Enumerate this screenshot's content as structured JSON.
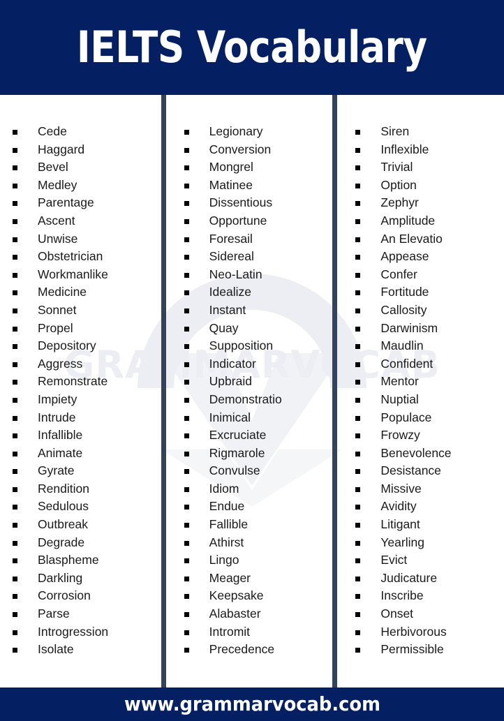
{
  "header": {
    "title": "IELTS Vocabulary",
    "background_color": "#042062",
    "text_color": "#ffffff"
  },
  "watermark": {
    "text": "GRAMMARVOCAB",
    "color": "#eceef3"
  },
  "theme": {
    "navy": "#042062",
    "divider": "#34425a",
    "bullet": "#000000",
    "word_text": "#1a1a1a",
    "page_background": "#ffffff"
  },
  "columns": [
    {
      "name": "column-1",
      "words": [
        "Cede",
        "Haggard",
        "Bevel",
        "Medley",
        "Parentage",
        "Ascent",
        "Unwise",
        "Obstetrician",
        "Workmanlike",
        "Medicine",
        "Sonnet",
        "Propel",
        "Depository",
        "Aggress",
        "Remonstrate",
        "Impiety",
        "Intrude",
        "Infallible",
        "Animate",
        "Gyrate",
        "Rendition",
        "Sedulous",
        "Outbreak",
        "Degrade",
        "Blaspheme",
        "Darkling",
        "Corrosion",
        "Parse",
        "Introgression",
        "Isolate"
      ]
    },
    {
      "name": "column-2",
      "words": [
        "Legionary",
        "Conversion",
        "Mongrel",
        "Matinee",
        "Dissentious",
        "Opportune",
        "Foresail",
        "Sidereal",
        "Neo-Latin",
        "Idealize",
        "Instant",
        "Quay",
        "Supposition",
        "Indicator",
        "Upbraid",
        "Demonstratio",
        "Inimical",
        "Excruciate",
        "Rigmarole",
        "Convulse",
        "Idiom",
        "Endue",
        "Fallible",
        "Athirst",
        "Lingo",
        "Meager",
        "Keepsake",
        "Alabaster",
        "Intromit",
        "Precedence"
      ]
    },
    {
      "name": "column-3",
      "words": [
        "Siren",
        "Inflexible",
        "Trivial",
        "Option",
        "Zephyr",
        "Amplitude",
        "An Elevatio",
        "Appease",
        "Confer",
        "Fortitude",
        "Callosity",
        "Darwinism",
        "Maudlin",
        "Confident",
        "Mentor",
        "Nuptial",
        "Populace",
        "Frowzy",
        "Benevolence",
        "Desistance",
        "Missive",
        "Avidity",
        "Litigant",
        "Yearling",
        "Evict",
        "Judicature",
        "Inscribe",
        "Onset",
        "Herbivorous",
        "Permissible"
      ]
    }
  ],
  "footer": {
    "url": "www.grammarvocab.com",
    "background_color": "#042062",
    "text_color": "#ffffff"
  }
}
